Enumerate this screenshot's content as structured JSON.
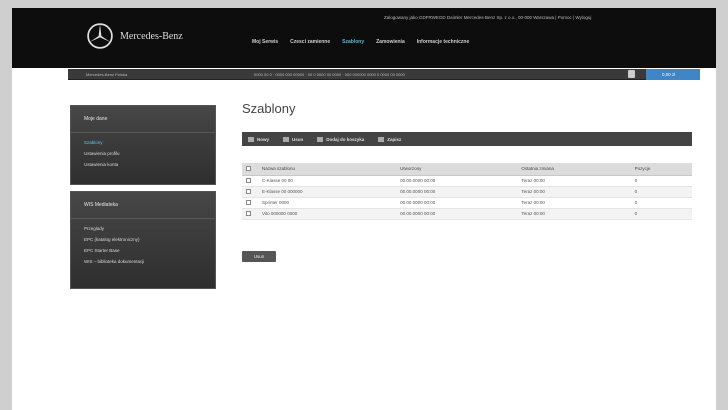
{
  "header": {
    "logo_text": "Mercedes-Benz",
    "top_line": "Zalogowany jako GDFRWEGD Daimler Mercedes-Benz Sp. z o.o., 00-000 Warszawa  |  Pomoc  |  Wyloguj",
    "nav": [
      "Moj Serwis",
      "Czesci zamienne",
      "Szablony",
      "Zamowienia",
      "Informacje techniczne"
    ]
  },
  "infobar": {
    "left": "Mercedes-Benz Polska",
    "middle": "0000 00 0 · 0000 000 00000 · 00 0 0000 00 0000 · 000 000000 0000 0 0000 00 0000",
    "cart": "0,00 zl"
  },
  "sidebar1": {
    "title": "Moje dane",
    "items": [
      "Szablony",
      "Ustawienia profilu",
      "Ustawienia konta"
    ]
  },
  "sidebar2": {
    "title": "WIS Mediateka",
    "items": [
      "Przeglady",
      "EPC (katalog elektroniczny)",
      "EPC Starter Base",
      "WIS – biblioteka dokumentacji"
    ]
  },
  "page": {
    "title": "Szablony",
    "toolbar": [
      "Nowy",
      "Usun",
      "Dodaj do koszyka",
      "Zapisz"
    ],
    "columns": [
      "Nazwa szablonu",
      "Utworzony",
      "Ostatnia zmiana",
      "Pozycje"
    ],
    "rows": [
      {
        "name": "C-Klasse 00 00",
        "created": "00.00.0000 00:00",
        "changed": "Teraz 00:00",
        "count": "0"
      },
      {
        "name": "E-Klasse 00 000000",
        "created": "00.00.0000 00:00",
        "changed": "Teraz 00:00",
        "count": "0"
      },
      {
        "name": "Sprinter 0000",
        "created": "00.00.0000 00:00",
        "changed": "Teraz 00:00",
        "count": "0"
      },
      {
        "name": "Vito 000000 0000",
        "created": "00.00.0000 00:00",
        "changed": "Teraz 00:00",
        "count": "0"
      }
    ],
    "button": "Usun"
  }
}
